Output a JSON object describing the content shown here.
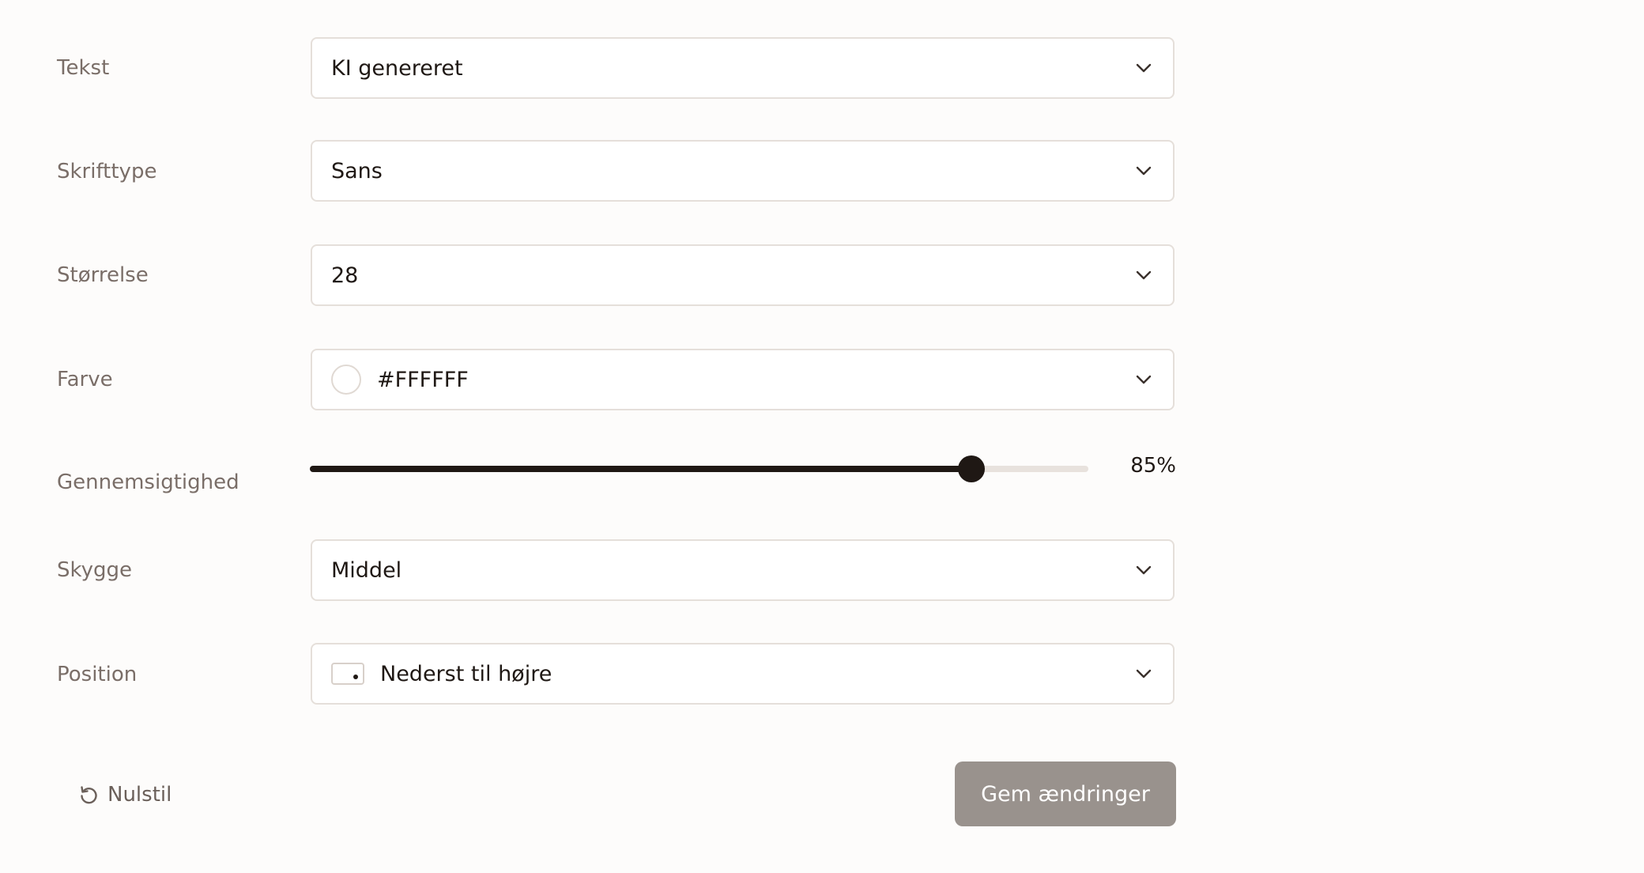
{
  "fields": {
    "tekst": {
      "label": "Tekst",
      "value": "KI genereret"
    },
    "skrifttype": {
      "label": "Skrifttype",
      "value": "Sans"
    },
    "stoerrelse": {
      "label": "Størrelse",
      "value": "28"
    },
    "farve": {
      "label": "Farve",
      "value": "#FFFFFF",
      "swatch_color": "#FFFFFF"
    },
    "gennemsigtighed": {
      "label": "Gennemsigtighed",
      "value_percent": 85,
      "value_text": "85%"
    },
    "skygge": {
      "label": "Skygge",
      "value": "Middel"
    },
    "position": {
      "label": "Position",
      "value": "Nederst til højre"
    }
  },
  "actions": {
    "reset_label": "Nulstil",
    "save_label": "Gem ændringer"
  },
  "icons": {
    "dropdown": "chevron-down-icon",
    "reset": "reset-icon",
    "position": "position-bottom-right-icon"
  },
  "colors": {
    "accent": "#1F1814",
    "save_button_bg": "#99928D",
    "border": "#E5DFDA",
    "label_text": "#7A6E68"
  }
}
